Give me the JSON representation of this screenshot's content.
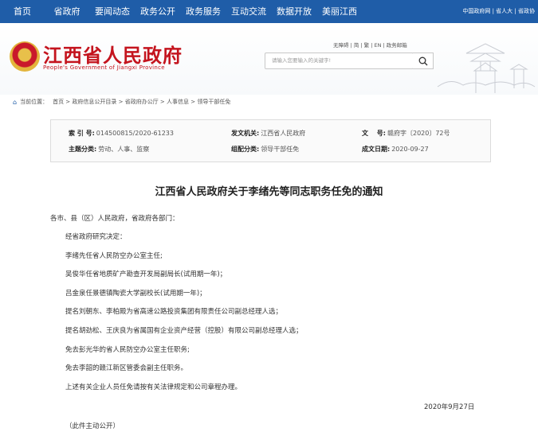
{
  "nav": {
    "items": [
      "首页",
      "省政府",
      "要闻动态",
      "政务公开",
      "政务服务",
      "互动交流",
      "数据开放",
      "美丽江西"
    ],
    "right": "中国政府网 | 省人大 | 省政协"
  },
  "header": {
    "title": "江西省人民政府",
    "subtitle": "People's Government of Jiangxi Province",
    "util_links": "无障碍 | 简 | 繁 | EN | 政务邮箱",
    "search_placeholder": "请输入您要输入的关键字!"
  },
  "breadcrumb": {
    "label": "当前位置：",
    "path": "首页 > 政府信息公开目录 > 省政府办公厅 > 人事信息 > 领导干部任免"
  },
  "meta": {
    "index_label": "索 引 号:",
    "index_value": "014500815/2020-61233",
    "issuer_label": "发文机关:",
    "issuer_value": "江西省人民政府",
    "docno_label": "文　 号:",
    "docno_value": "赣府字〔2020〕72号",
    "topic_label": "主题分类:",
    "topic_value": "劳动、人事、监察",
    "category_label": "组配分类:",
    "category_value": "领导干部任免",
    "date_label": "成文日期:",
    "date_value": "2020-09-27"
  },
  "document": {
    "title": "江西省人民政府关于李绪先等同志职务任免的通知",
    "salutation": "各市、县（区）人民政府，省政府各部门：",
    "lines": [
      "经省政府研究决定：",
      "李绪先任省人民防空办公室主任;",
      "吴俊华任省地质矿产勘查开发局副局长(试用期一年)；",
      "吕金泉任景德镇陶瓷大学副校长(试用期一年)；",
      "提名刘朝东、李柏殿为省高速公路投资集团有限责任公司副总经理人选；",
      "提名胡劲松、王庆良为省属国有企业资产经营（控股）有限公司副总经理人选；",
      "免去彭光华的省人民防空办公室主任职务;",
      "免去李韶的赣江新区管委会副主任职务。",
      "上述有关企业人员任免请按有关法律规定和公司章程办理。"
    ],
    "date": "2020年9月27日",
    "footer": "（此件主动公开）"
  }
}
